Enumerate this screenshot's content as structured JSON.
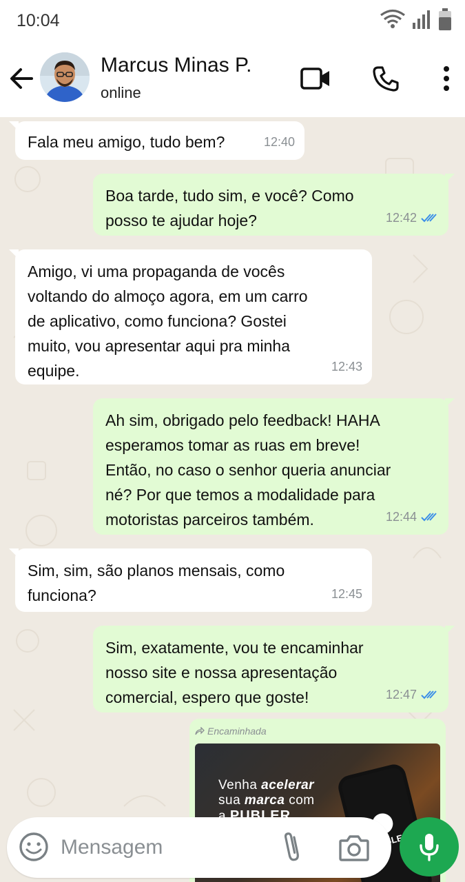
{
  "status_bar": {
    "time": "10:04"
  },
  "header": {
    "contact_name": "Marcus Minas P.",
    "contact_status": "online",
    "icons": [
      "back-arrow-icon",
      "video-call-icon",
      "phone-icon",
      "more-vert-icon"
    ]
  },
  "messages": [
    {
      "direction": "in",
      "text": "Fala meu amigo, tudo bem?",
      "time": "12:40"
    },
    {
      "direction": "out",
      "text": "Boa tarde, tudo sim, e você? Como\nposso te ajudar hoje?",
      "time": "12:42",
      "read": true
    },
    {
      "direction": "in",
      "text": "Amigo, vi uma propaganda de vocês\nvoltando do almoço agora, em um carro\nde aplicativo, como funciona? Gostei\nmuito, vou apresentar aqui pra minha\nequipe.",
      "time": "12:43"
    },
    {
      "direction": "out",
      "text": "Ah sim, obrigado pelo feedback! HAHA\nesperamos tomar as ruas em breve!\nEntão, no caso o senhor queria anunciar\nné? Por que temos a modalidade para\nmotoristas parceiros também.",
      "time": "12:44",
      "read": true
    },
    {
      "direction": "in",
      "text": "Sim, sim, são planos mensais, como\nfunciona?",
      "time": "12:45"
    },
    {
      "direction": "out",
      "text": "Sim, exatamente, vou te encaminhar\nnosso site e nossa apresentação\ncomercial, espero que goste!",
      "time": "12:47",
      "read": true
    }
  ],
  "forwarded": {
    "label": "Encaminhada",
    "promo_line1_a": "Venha ",
    "promo_line1_b": "acelerar",
    "promo_line2_a": "sua ",
    "promo_line2_b": "marca",
    "promo_line2_c": " com",
    "promo_line3_a": "a ",
    "promo_line3_b": "PUBLER",
    "phone_text": "PUBLER"
  },
  "composer": {
    "placeholder": "Mensagem"
  },
  "colors": {
    "outgoing_bubble": "#e2fbd4",
    "incoming_bubble": "#ffffff",
    "chat_background": "#efeae2",
    "mic_button": "#1da851",
    "read_tick": "#3b8ee8"
  }
}
